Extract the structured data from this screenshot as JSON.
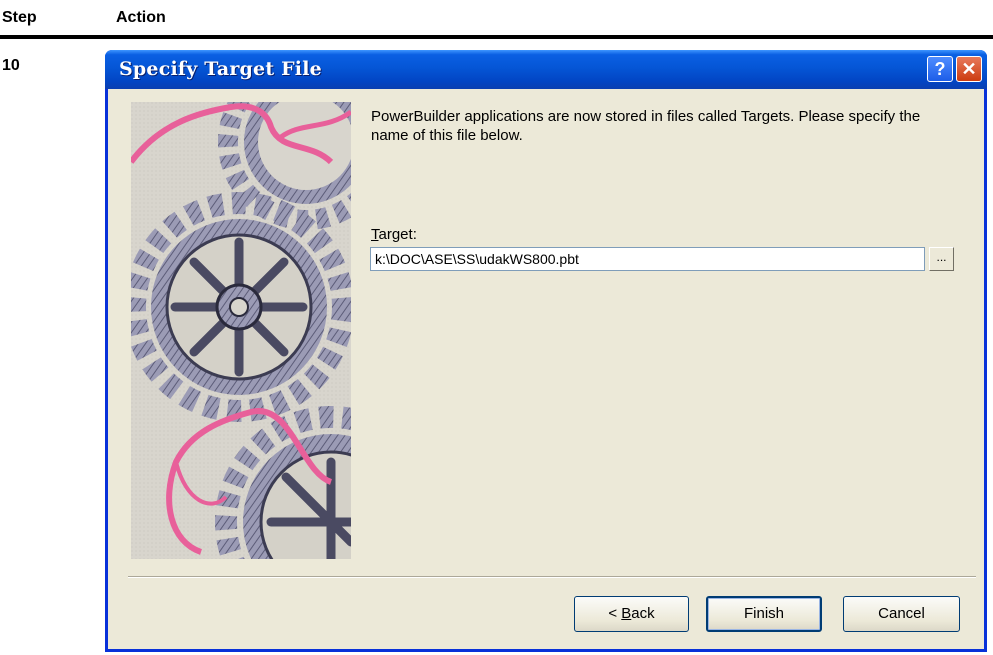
{
  "doc": {
    "step_header": "Step",
    "action_header": "Action",
    "step_number": "10"
  },
  "dialog": {
    "title": "Specify Target File",
    "help_glyph": "?",
    "close_glyph": "✕",
    "message": "PowerBuilder applications are now stored in files called Targets.  Please specify the name of this file below.",
    "target_label_mnemonic": "T",
    "target_label_rest": "arget:",
    "target_value": "k:\\DOC\\ASE\\SS\\udakWS800.pbt",
    "browse_label": "...",
    "back_label_prefix": "< ",
    "back_label_mnemonic": "B",
    "back_label_rest": "ack",
    "finish_label": "Finish",
    "cancel_label": "Cancel"
  },
  "icons": {
    "help": "help-icon",
    "close": "close-icon",
    "art": "gears-illustration"
  },
  "colors": {
    "title_bar": "#0556d6",
    "client_bg": "#ece9d8",
    "ribbon": "#e8609a",
    "gear": "#8a8aa6"
  }
}
